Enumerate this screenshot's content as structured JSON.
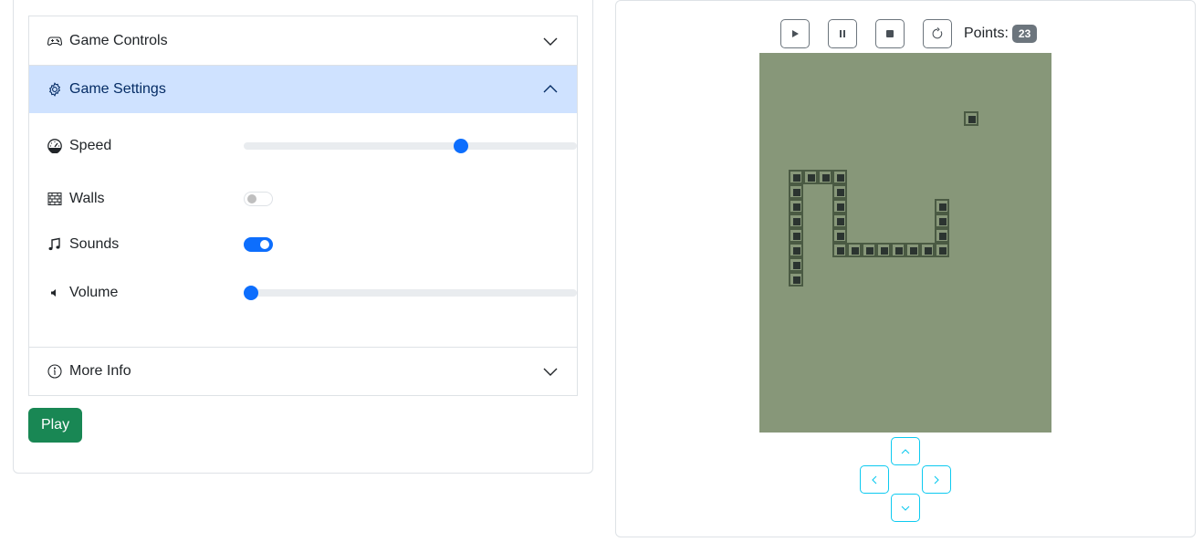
{
  "left_panel": {
    "accordion": [
      {
        "label": "Game Controls",
        "icon": "gamepad-icon",
        "expanded": false
      },
      {
        "label": "Game Settings",
        "icon": "gear-icon",
        "expanded": true
      },
      {
        "label": "More Info",
        "icon": "info-circle-icon",
        "expanded": false
      }
    ],
    "settings": {
      "speed": {
        "label": "Speed",
        "icon": "speedometer-icon",
        "value_percent": 66
      },
      "walls": {
        "label": "Walls",
        "icon": "bricks-icon",
        "on": false
      },
      "sounds": {
        "label": "Sounds",
        "icon": "music-note-icon",
        "on": true
      },
      "volume": {
        "label": "Volume",
        "icon": "volume-icon",
        "value_percent": 0
      }
    },
    "play_button": "Play"
  },
  "right_panel": {
    "toolbar": {
      "buttons": [
        "play",
        "pause",
        "stop",
        "restart"
      ],
      "points_label": "Points:",
      "points_value": "23"
    },
    "board": {
      "cols": 20,
      "rows": 26,
      "colors": {
        "background": "#879779",
        "cell_border": "#4a5a43",
        "cell_fill": "#2b3430"
      },
      "food": [
        14,
        4
      ],
      "snake": [
        [
          2,
          15
        ],
        [
          2,
          14
        ],
        [
          2,
          13
        ],
        [
          2,
          12
        ],
        [
          2,
          11
        ],
        [
          2,
          10
        ],
        [
          2,
          9
        ],
        [
          2,
          8
        ],
        [
          3,
          8
        ],
        [
          4,
          8
        ],
        [
          5,
          8
        ],
        [
          5,
          9
        ],
        [
          5,
          10
        ],
        [
          5,
          11
        ],
        [
          5,
          12
        ],
        [
          5,
          13
        ],
        [
          6,
          13
        ],
        [
          7,
          13
        ],
        [
          8,
          13
        ],
        [
          9,
          13
        ],
        [
          10,
          13
        ],
        [
          11,
          13
        ],
        [
          12,
          13
        ],
        [
          12,
          12
        ],
        [
          12,
          11
        ],
        [
          12,
          10
        ]
      ]
    },
    "dpad": [
      "up",
      "left",
      "right",
      "down"
    ]
  }
}
